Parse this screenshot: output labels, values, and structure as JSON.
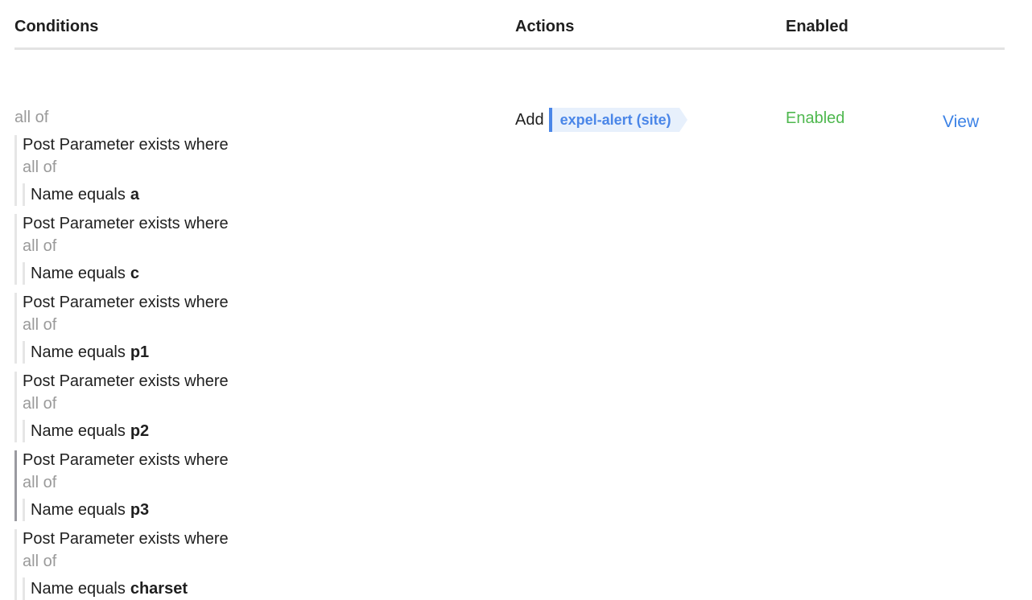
{
  "headers": {
    "conditions": "Conditions",
    "actions": "Actions",
    "enabled": "Enabled"
  },
  "rule": {
    "root_operator": "all of",
    "groups": [
      {
        "title": "Post Parameter exists where",
        "operator": "all of",
        "clause_prefix": "Name equals",
        "clause_value": "a"
      },
      {
        "title": "Post Parameter exists where",
        "operator": "all of",
        "clause_prefix": "Name equals",
        "clause_value": "c"
      },
      {
        "title": "Post Parameter exists where",
        "operator": "all of",
        "clause_prefix": "Name equals",
        "clause_value": "p1"
      },
      {
        "title": "Post Parameter exists where",
        "operator": "all of",
        "clause_prefix": "Name equals",
        "clause_value": "p2"
      },
      {
        "title": "Post Parameter exists where",
        "operator": "all of",
        "clause_prefix": "Name equals",
        "clause_value": "p3"
      },
      {
        "title": "Post Parameter exists where",
        "operator": "all of",
        "clause_prefix": "Name equals",
        "clause_value": "charset"
      }
    ],
    "action_verb": "Add",
    "action_tag": "expel-alert (site)",
    "status": "Enabled",
    "view_link": "View"
  },
  "colors": {
    "enabled": "#4fb84f",
    "link": "#3c82e6",
    "tag_text": "#4a86e8",
    "tag_bg": "#e7f0fc"
  }
}
